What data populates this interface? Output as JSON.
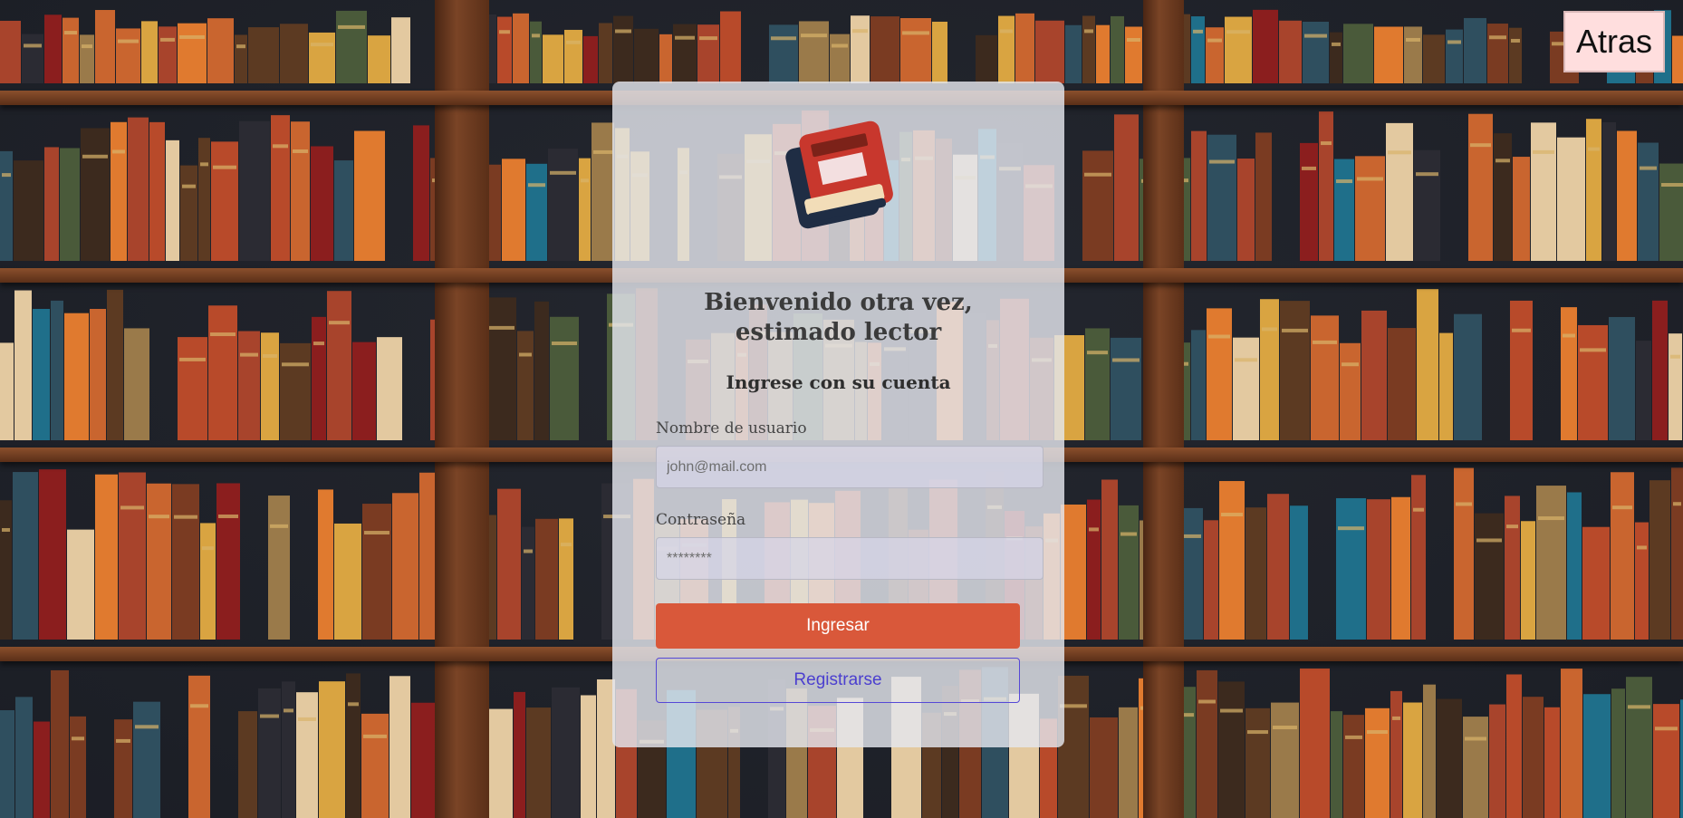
{
  "header": {
    "back_label": "Atras"
  },
  "login": {
    "title": "Bienvenido otra vez, estimado lector",
    "subtitle": "Ingrese con su cuenta",
    "username_label": "Nombre de usuario",
    "username_placeholder": "john@mail.com",
    "password_label": "Contraseña",
    "password_placeholder": "********",
    "submit_label": "Ingresar",
    "register_label": "Registrarse"
  },
  "icons": {
    "logo": "books-logo-icon"
  },
  "colors": {
    "primary_button": "#d9583a",
    "secondary_button_text": "#4b3fcf",
    "back_button_bg": "#ffdede",
    "logo_red": "#c8372d",
    "logo_navy": "#1f2d44"
  }
}
